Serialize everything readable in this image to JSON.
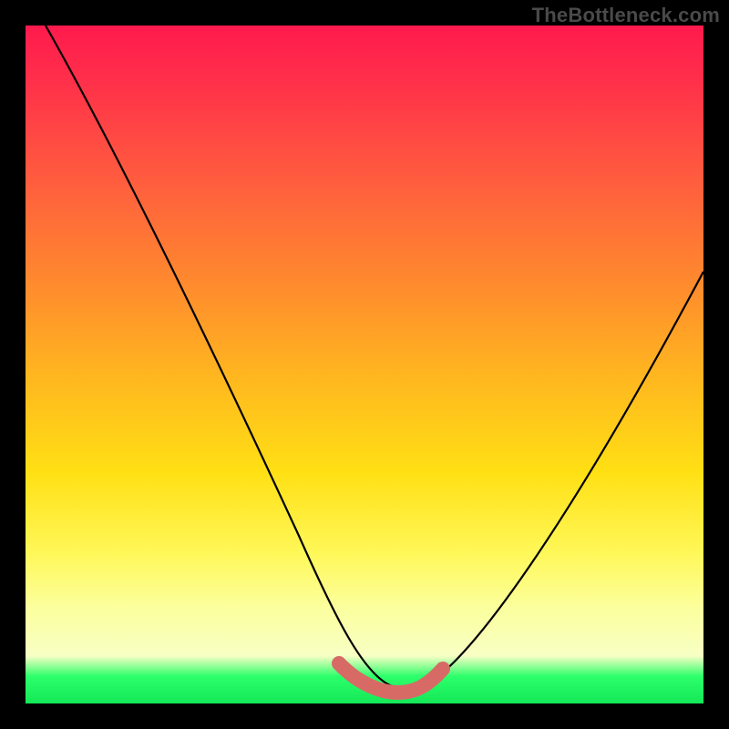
{
  "watermark": "TheBottleneck.com",
  "chart_data": {
    "type": "line",
    "title": "",
    "xlabel": "",
    "ylabel": "",
    "xlim": [
      0,
      100
    ],
    "ylim": [
      0,
      100
    ],
    "series": [
      {
        "name": "bottleneck-curve",
        "x": [
          3,
          10,
          20,
          30,
          40,
          46,
          50,
          54,
          58,
          60,
          70,
          80,
          90,
          100
        ],
        "y": [
          100,
          86,
          67,
          48,
          28,
          12,
          4,
          2,
          2,
          4,
          18,
          36,
          52,
          64
        ]
      }
    ],
    "highlight_segment": {
      "name": "optimal-range",
      "x": [
        46,
        50,
        54,
        58,
        60
      ],
      "y": [
        6,
        2.5,
        2,
        2.5,
        5
      ]
    },
    "gradient_stops": [
      {
        "pos": 0.0,
        "color": "#ff1a4d"
      },
      {
        "pos": 0.38,
        "color": "#ff8a2e"
      },
      {
        "pos": 0.66,
        "color": "#ffe014"
      },
      {
        "pos": 0.93,
        "color": "#f7ffc4"
      },
      {
        "pos": 1.0,
        "color": "#14e858"
      }
    ]
  }
}
